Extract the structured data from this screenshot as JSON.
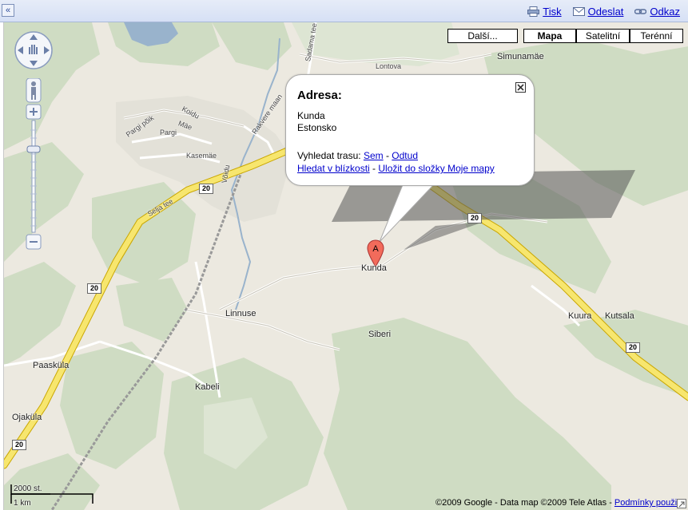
{
  "toolbar": {
    "collapse": "«",
    "print": "Tisk",
    "send": "Odeslat",
    "link": "Odkaz"
  },
  "maptypes": {
    "more": "Další...",
    "map": "Mapa",
    "satellite": "Satelitní",
    "terrain": "Terénní"
  },
  "infowindow": {
    "title": "Adresa:",
    "line1": "Kunda",
    "line2": "Estonsko",
    "route_prefix": "Vyhledat trasu: ",
    "route_here": "Sem",
    "route_sep": " - ",
    "route_from": "Odtud",
    "nearby": "Hledat v blízkosti",
    "save": "Uložit do složky Moje mapy"
  },
  "marker": {
    "letter": "A",
    "label": "Kunda"
  },
  "places": {
    "lontova": "Lontova",
    "simunamae": "Simunamäe",
    "koidu": "Koidu",
    "mae": "Mäe",
    "pargi_polik": "Pargi põik",
    "pargi": "Pargi",
    "kasemae": "Kasemäe",
    "voidu": "Võidu",
    "rakvere": "Rakvere maan",
    "sadama": "Sadama tee",
    "selja": "Selja tee",
    "linnuse": "Linnuse",
    "siberi": "Siberi",
    "kuura": "Kuura",
    "kutsala": "Kutsala",
    "paaskula": "Paasküla",
    "kabeli": "Kabeli",
    "ojakula": "Ojaküla"
  },
  "roadnumber": "20",
  "scale": {
    "top": "2000 st.",
    "bottom": "1 km"
  },
  "copyright": {
    "text": "©2009 Google - Data map ©2009 Tele Atlas - ",
    "terms": "Podmínky použití"
  }
}
